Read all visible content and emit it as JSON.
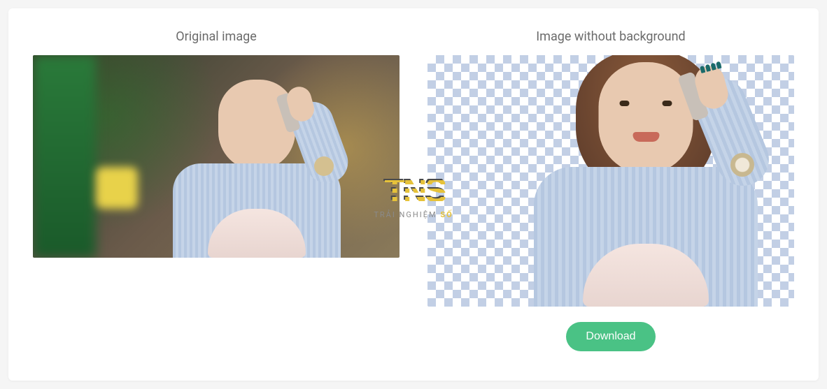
{
  "labels": {
    "original": "Original image",
    "nobg": "Image without background"
  },
  "actions": {
    "download": "Download"
  },
  "watermark": {
    "logo": "TNS",
    "tag_prefix": "TRẢI NGHIỆM ",
    "tag_accent": "SỐ"
  }
}
